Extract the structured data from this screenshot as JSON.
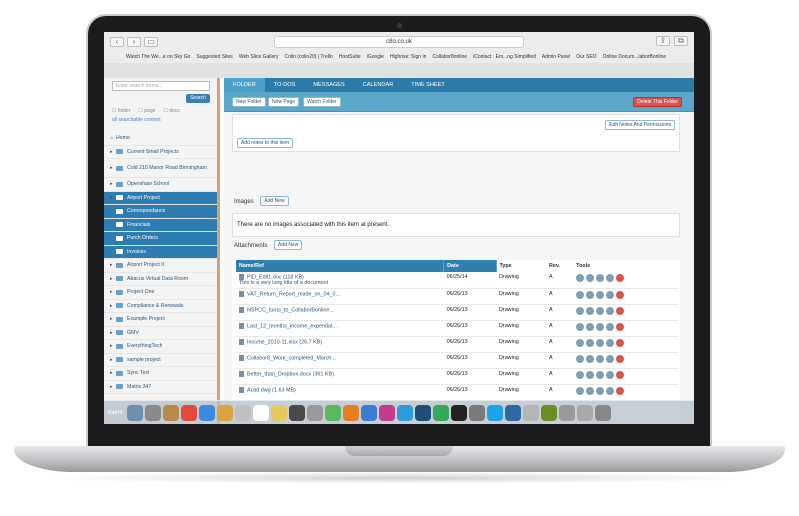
{
  "browser": {
    "url": "c8o.co.uk",
    "bookmarks": [
      "Watch The We...e on Sky Go",
      "Suggested Sites",
      "Web Slice Gallery",
      "Colin (colin20) | Trello",
      "HootSuite",
      "iGoogle",
      "Highrise: Sign in",
      "Collabor8online",
      "iContact : Em...ng Simplified",
      "Admin Panel",
      "Our SEO",
      "Online Docum...laborBonline"
    ]
  },
  "sidebar": {
    "search_placeholder": "Enter search terms...",
    "search_button": "Search",
    "filters": [
      "folder",
      "page",
      "docs"
    ],
    "all_searchable": "all searchable content",
    "items": [
      {
        "label": "Home",
        "type": "home"
      },
      {
        "label": "Current Small Projects",
        "type": "folder"
      },
      {
        "label": "Cold 210 Manor Road Birmingham",
        "type": "folder"
      },
      {
        "label": "Openshaw School",
        "type": "folder"
      },
      {
        "label": "Airport Project",
        "type": "selected"
      },
      {
        "label": "Correspondance",
        "type": "sub"
      },
      {
        "label": "Financials",
        "type": "sub"
      },
      {
        "label": "Purch Orders",
        "type": "sub"
      },
      {
        "label": "Invoices",
        "type": "sub"
      },
      {
        "label": "Airport Project II",
        "type": "folder"
      },
      {
        "label": "Abacus Virtual Data Room",
        "type": "folder"
      },
      {
        "label": "Project One",
        "type": "folder"
      },
      {
        "label": "Compliance & Renewals",
        "type": "folder"
      },
      {
        "label": "Example Project",
        "type": "folder"
      },
      {
        "label": "GMV",
        "type": "folder"
      },
      {
        "label": "EverythingTech",
        "type": "folder"
      },
      {
        "label": "sample project",
        "type": "folder"
      },
      {
        "label": "Sync Test",
        "type": "folder"
      },
      {
        "label": "Matrix 347",
        "type": "folder"
      }
    ]
  },
  "tabs": [
    "FOLDER",
    "TO-DOS",
    "MESSAGES",
    "CALENDAR",
    "TIME SHEET"
  ],
  "toolbar": {
    "new_folder": "New Folder",
    "new_page": "New Page",
    "watch_folder": "Watch Folder",
    "delete": "Delete This Folder"
  },
  "notes": {
    "edit_perms": "Edit Notes And Permissions",
    "add_notes": "Add notes to this item"
  },
  "images": {
    "heading": "Images",
    "add": "Add New",
    "empty": "There are no images associated with this item at present."
  },
  "attachments": {
    "heading": "Attachments",
    "add": "Add New",
    "columns": [
      "Name/Ref",
      "Date",
      "Type",
      "Rev.",
      "Tools"
    ],
    "rows": [
      {
        "name": "PID_Edit1.doc (118 KB)\nThis is a very long title of a document",
        "date": "06/25/14",
        "type": "Drawing",
        "rev": "A"
      },
      {
        "name": "VAT_Return_Report_made_on_04_0...",
        "date": "06/26/13",
        "type": "Drawing",
        "rev": "A"
      },
      {
        "name": "NSPCC_turns_to_CollaborBonline...",
        "date": "06/26/13",
        "type": "Drawing",
        "rev": "A"
      },
      {
        "name": "Last_12_months_income_expendat...",
        "date": "06/26/13",
        "type": "Drawing",
        "rev": "A"
      },
      {
        "name": "Income_2010-11.xlsx (26.7 KB)",
        "date": "06/26/13",
        "type": "Drawing",
        "rev": "A"
      },
      {
        "name": "Collabor8_Work_completed_March...",
        "date": "06/26/13",
        "type": "Drawing",
        "rev": "A"
      },
      {
        "name": "Better_than_Dropbox.docx (361 KB)",
        "date": "06/26/13",
        "type": "Drawing",
        "rev": "A"
      },
      {
        "name": "Acad.dwg (1.63 MB)",
        "date": "06/26/13",
        "type": "Drawing",
        "rev": "A"
      }
    ]
  },
  "dock": {
    "label": "event",
    "icon_colors": [
      "#6d8fb0",
      "#8a8a8a",
      "#b88a4a",
      "#e24b3b",
      "#3d8be0",
      "#d9a441",
      "#c0c0c0",
      "#ffffff",
      "#e6c95b",
      "#4a4a4a",
      "#9a9a9a",
      "#5cb85c",
      "#e57e22",
      "#3a7bd5",
      "#c43c8c",
      "#2d9cdb",
      "#1f4e79",
      "#33aa55",
      "#222222",
      "#7a7a7a",
      "#1aa3e8",
      "#2b6aa3",
      "#b5b5b5",
      "#6b8e23",
      "#999999",
      "#aaaaaa",
      "#888888"
    ]
  }
}
